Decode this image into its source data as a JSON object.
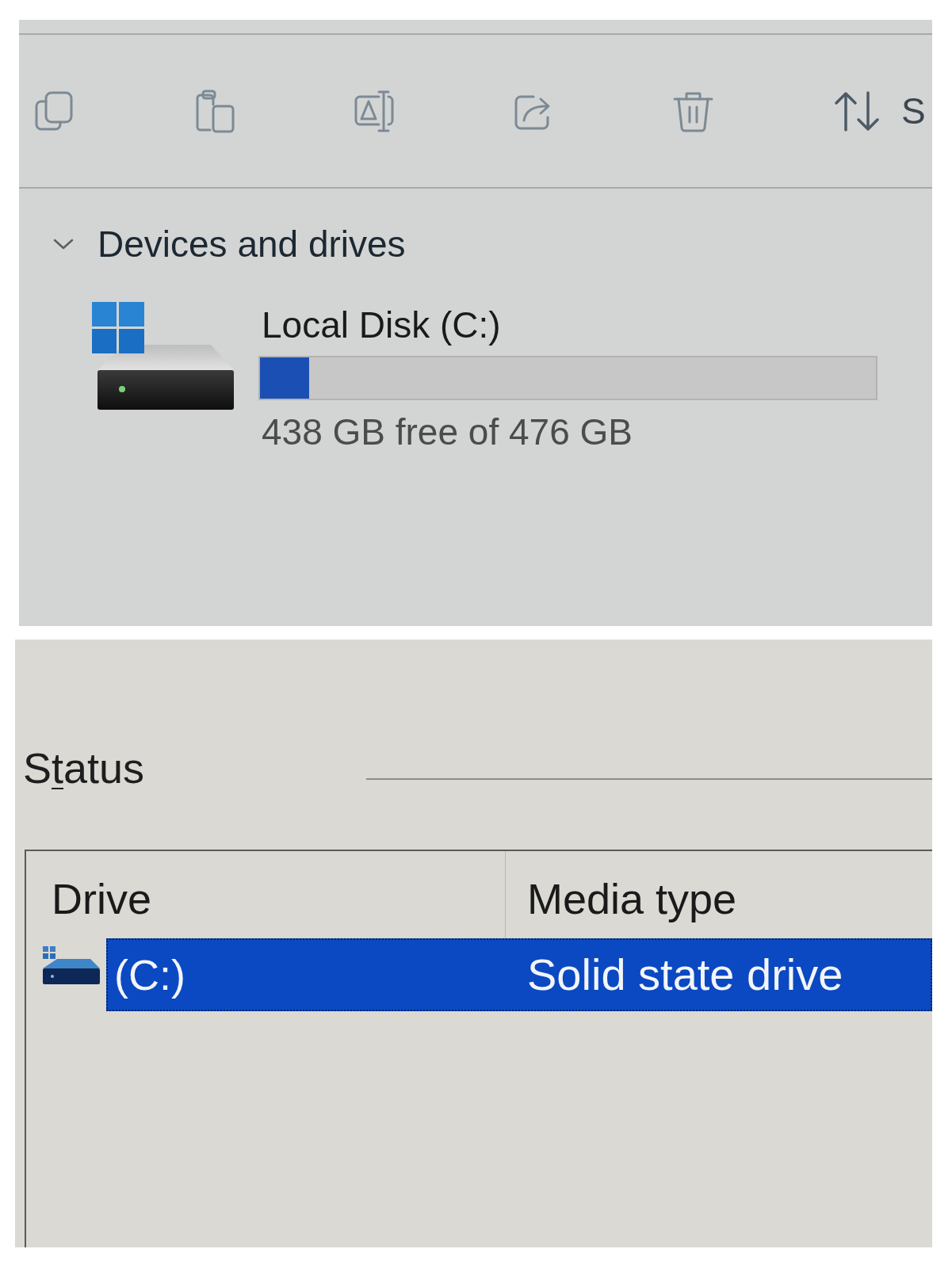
{
  "toolbar": {
    "sort_label": "S"
  },
  "section": {
    "title": "Devices and drives",
    "expanded": true
  },
  "drives": [
    {
      "name": "Local Disk (C:)",
      "level": 0.08,
      "space": "438 GB free of 476 GB"
    }
  ],
  "status": {
    "label_parts": [
      {
        "text": "S",
        "underlined": false
      },
      {
        "text": "t",
        "underlined": true
      },
      {
        "text": "atus",
        "underlined": false
      }
    ]
  },
  "table": {
    "columns": [
      "Drive",
      "Media type"
    ],
    "rows": [
      {
        "drive": "(C:)",
        "media_type": "Solid state drive",
        "selected": true
      }
    ]
  }
}
